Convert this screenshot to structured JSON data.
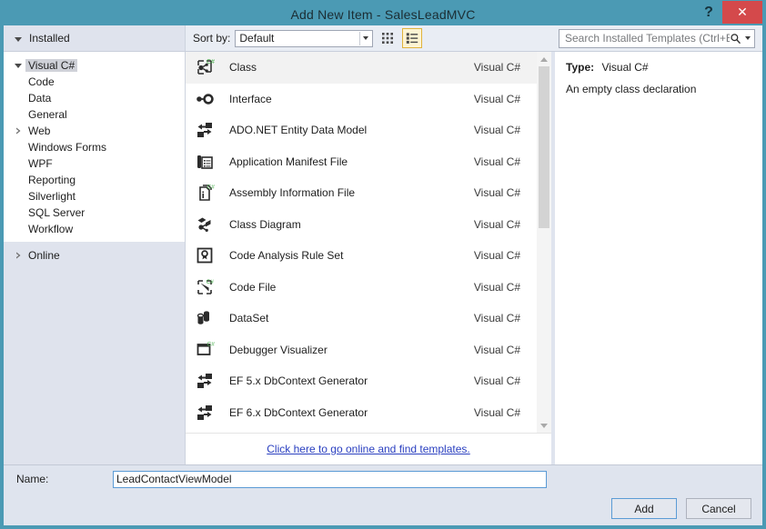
{
  "window": {
    "title": "Add New Item - SalesLeadMVC",
    "help_label": "?",
    "close_label": "✕"
  },
  "toolbar": {
    "installed_header": "Installed",
    "sort_by_label": "Sort by:",
    "sort_by_value": "Default",
    "grid_view_icon": "grid-view-icon",
    "list_view_icon": "list-view-icon",
    "search_placeholder": "Search Installed Templates (Ctrl+E)",
    "search_value": ""
  },
  "sidebar": {
    "items": [
      {
        "label": "Visual C#",
        "level": 1,
        "twisty": "open",
        "selected": true
      },
      {
        "label": "Code",
        "level": 2,
        "twisty": "none",
        "selected": false
      },
      {
        "label": "Data",
        "level": 2,
        "twisty": "none",
        "selected": false
      },
      {
        "label": "General",
        "level": 2,
        "twisty": "none",
        "selected": false
      },
      {
        "label": "Web",
        "level": 2,
        "twisty": "closed",
        "selected": false
      },
      {
        "label": "Windows Forms",
        "level": 2,
        "twisty": "none",
        "selected": false
      },
      {
        "label": "WPF",
        "level": 2,
        "twisty": "none",
        "selected": false
      },
      {
        "label": "Reporting",
        "level": 2,
        "twisty": "none",
        "selected": false
      },
      {
        "label": "Silverlight",
        "level": 2,
        "twisty": "none",
        "selected": false
      },
      {
        "label": "SQL Server",
        "level": 2,
        "twisty": "none",
        "selected": false
      },
      {
        "label": "Workflow",
        "level": 2,
        "twisty": "none",
        "selected": false
      }
    ],
    "online": {
      "label": "Online",
      "twisty": "closed"
    }
  },
  "templates": {
    "items": [
      {
        "name": "Class",
        "language": "Visual C#",
        "icon": "class-icon",
        "selected": true
      },
      {
        "name": "Interface",
        "language": "Visual C#",
        "icon": "interface-icon",
        "selected": false
      },
      {
        "name": "ADO.NET Entity Data Model",
        "language": "Visual C#",
        "icon": "entity-data-model-icon",
        "selected": false
      },
      {
        "name": "Application Manifest File",
        "language": "Visual C#",
        "icon": "application-manifest-icon",
        "selected": false
      },
      {
        "name": "Assembly Information File",
        "language": "Visual C#",
        "icon": "assembly-information-icon",
        "selected": false
      },
      {
        "name": "Class Diagram",
        "language": "Visual C#",
        "icon": "class-diagram-icon",
        "selected": false
      },
      {
        "name": "Code Analysis Rule Set",
        "language": "Visual C#",
        "icon": "code-analysis-rule-set-icon",
        "selected": false
      },
      {
        "name": "Code File",
        "language": "Visual C#",
        "icon": "code-file-icon",
        "selected": false
      },
      {
        "name": "DataSet",
        "language": "Visual C#",
        "icon": "dataset-icon",
        "selected": false
      },
      {
        "name": "Debugger Visualizer",
        "language": "Visual C#",
        "icon": "debugger-visualizer-icon",
        "selected": false
      },
      {
        "name": "EF 5.x DbContext Generator",
        "language": "Visual C#",
        "icon": "entity-data-model-icon",
        "selected": false
      },
      {
        "name": "EF 6.x DbContext Generator",
        "language": "Visual C#",
        "icon": "entity-data-model-icon",
        "selected": false
      },
      {
        "name": "",
        "language": "",
        "icon": "entity-data-model-icon",
        "selected": false
      }
    ],
    "online_link": "Click here to go online and find templates."
  },
  "info": {
    "type_label": "Type:",
    "type_value": "Visual C#",
    "description": "An empty class declaration"
  },
  "footer": {
    "name_label": "Name:",
    "name_value": "LeadContactViewModel",
    "add_label": "Add",
    "cancel_label": "Cancel"
  },
  "colors": {
    "titlebar": "#4b9ab4",
    "close_button": "#d4494b",
    "dialog_background": "#dfe4ee",
    "accent_link": "#2b40c0",
    "focus_border": "#5b9bd5",
    "selected_row": "#f2f2f2",
    "view_toggle_active": "#e0b33c"
  }
}
